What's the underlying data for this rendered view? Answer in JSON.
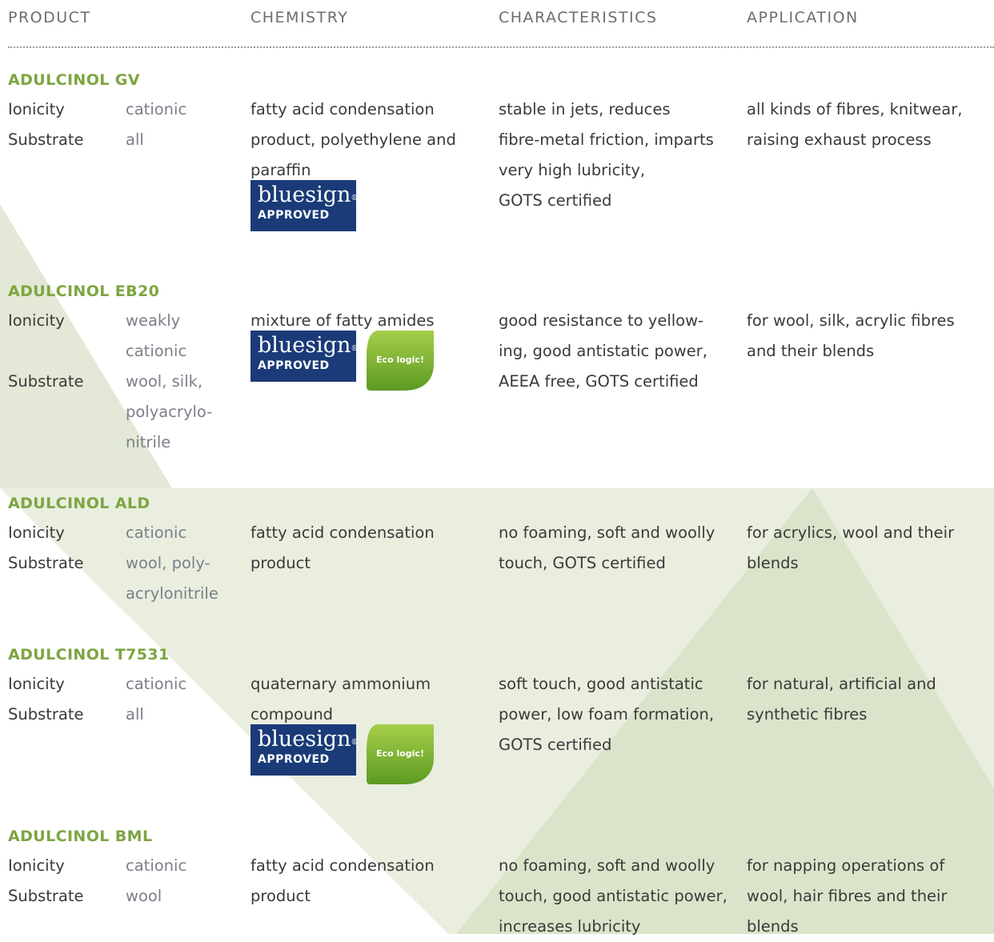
{
  "headers": [
    "PRODUCT",
    "CHEMISTRY",
    "CHARACTERISTICS",
    "APPLICATION"
  ],
  "labels": {
    "ionicity": "Ionicity",
    "substrate": "Substrate"
  },
  "badges": {
    "bluesign_line1": "bluesign",
    "bluesign_reg": "®",
    "bluesign_line2": "APPROVED",
    "eco": "Eco logic!"
  },
  "products": [
    {
      "name": "ADULCINOL GV",
      "ionicity": [
        "cationic"
      ],
      "substrate": [
        "all"
      ],
      "chemistry": [
        "fatty acid condensation",
        "product, polyethylene and",
        "paraffin"
      ],
      "characteristics": [
        "stable in jets, reduces",
        "fibre-metal friction, imparts",
        "very high lubricity,",
        "GOTS certified"
      ],
      "application": [
        "all kinds of fibres, knitwear,",
        "raising exhaust process"
      ],
      "bluesign": true,
      "eco_logic": false
    },
    {
      "name": "ADULCINOL EB20",
      "ionicity": [
        "weakly",
        "cationic"
      ],
      "substrate": [
        "wool, silk,",
        "polyacrylo-",
        "nitrile"
      ],
      "chemistry": [
        "mixture of fatty amides"
      ],
      "characteristics": [
        "good resistance to yellow-",
        "ing, good antistatic power,",
        "AEEA free, GOTS certified"
      ],
      "application": [
        "for wool, silk, acrylic fibres",
        "and their blends"
      ],
      "bluesign": true,
      "eco_logic": true
    },
    {
      "name": "ADULCINOL ALD",
      "ionicity": [
        "cationic"
      ],
      "substrate": [
        "wool, poly-",
        "acrylonitrile"
      ],
      "chemistry": [
        "fatty acid condensation",
        "product"
      ],
      "characteristics": [
        "no foaming, soft and woolly",
        "touch, GOTS certified"
      ],
      "application": [
        "for acrylics, wool and their",
        "blends"
      ],
      "bluesign": false,
      "eco_logic": false
    },
    {
      "name": "ADULCINOL T7531",
      "ionicity": [
        "cationic"
      ],
      "substrate": [
        "all"
      ],
      "chemistry": [
        "quaternary ammonium",
        "compound"
      ],
      "characteristics": [
        "soft touch, good antistatic",
        "power, low foam formation,",
        "GOTS certified"
      ],
      "application": [
        "for natural, artificial and",
        "synthetic fibres"
      ],
      "bluesign": true,
      "eco_logic": true
    },
    {
      "name": "ADULCINOL BML",
      "ionicity": [
        "cationic"
      ],
      "substrate": [
        "wool"
      ],
      "chemistry": [
        "fatty acid condensation",
        "product"
      ],
      "characteristics": [
        "no foaming, soft and woolly",
        "touch, good antistatic power,",
        "increases lubricity"
      ],
      "application": [
        "for napping operations of",
        "wool, hair fibres and their",
        "blends"
      ],
      "bluesign": false,
      "eco_logic": false
    }
  ]
}
